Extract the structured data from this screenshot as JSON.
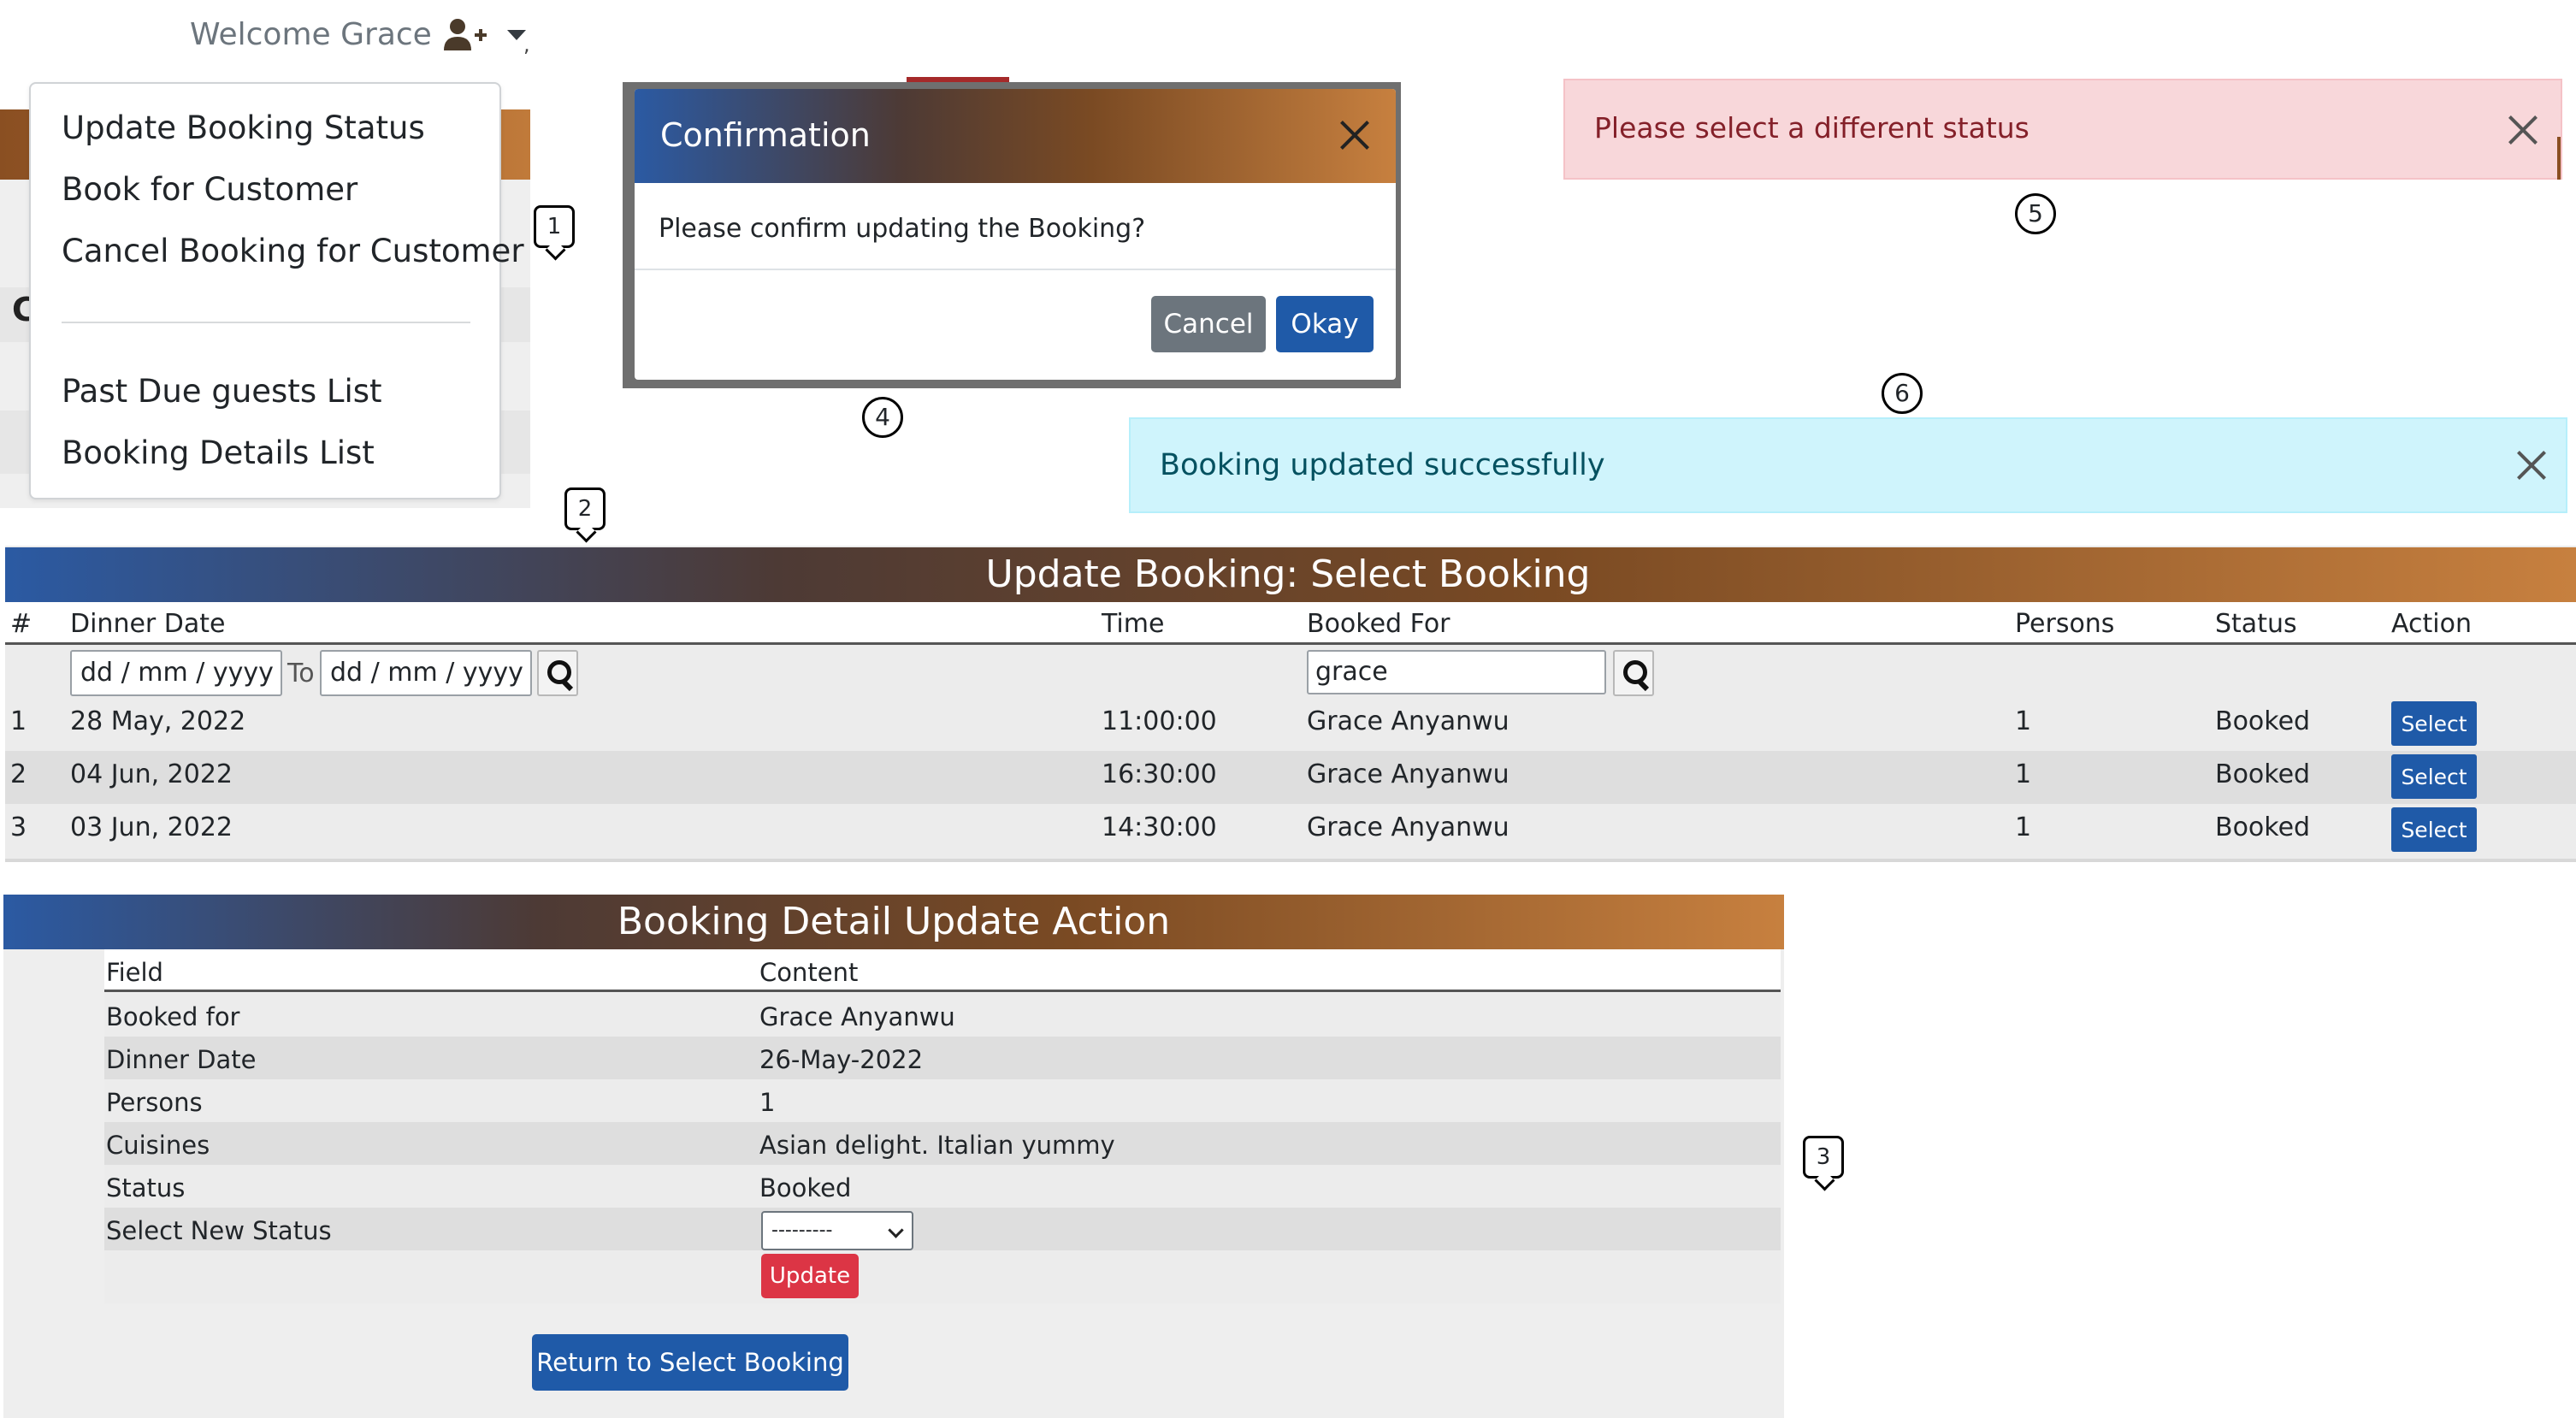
{
  "nav": {
    "welcome": "Welcome Grace",
    "menu_items": [
      "Update Booking Status",
      "Book for Customer",
      "Cancel Booking for Customer",
      "Past Due guests List",
      "Booking Details List"
    ],
    "background_letter": "C",
    "stray_mark": ","
  },
  "callouts": {
    "c1": "1",
    "c2": "2",
    "c3": "3",
    "c4": "4",
    "c5": "5",
    "c6": "6"
  },
  "modal": {
    "title": "Confirmation",
    "body": "Please confirm updating the Booking?",
    "cancel_label": "Cancel",
    "okay_label": "Okay"
  },
  "alerts": {
    "danger": "Please select a different status",
    "info": "Booking updated successfully"
  },
  "select_booking": {
    "title": "Update Booking: Select Booking",
    "columns": [
      "#",
      "Dinner Date",
      "Time",
      "Booked For",
      "Persons",
      "Status",
      "Action"
    ],
    "filters": {
      "date_from_placeholder": "dd / mm / yyyy",
      "to_label": "To",
      "date_to_placeholder": "dd / mm / yyyy",
      "search_value": "grace"
    },
    "rows": [
      {
        "n": "1",
        "date": "28 May, 2022",
        "time": "11:00:00",
        "booked_for": "Grace Anyanwu",
        "persons": "1",
        "status": "Booked",
        "action": "Select"
      },
      {
        "n": "2",
        "date": "04 Jun, 2022",
        "time": "16:30:00",
        "booked_for": "Grace Anyanwu",
        "persons": "1",
        "status": "Booked",
        "action": "Select"
      },
      {
        "n": "3",
        "date": "03 Jun, 2022",
        "time": "14:30:00",
        "booked_for": "Grace Anyanwu",
        "persons": "1",
        "status": "Booked",
        "action": "Select"
      }
    ]
  },
  "booking_detail": {
    "title": "Booking Detail Update Action",
    "col_field": "Field",
    "col_content": "Content",
    "rows": [
      {
        "field": "Booked for",
        "content": "Grace Anyanwu"
      },
      {
        "field": "Dinner Date",
        "content": "26-May-2022"
      },
      {
        "field": "Persons",
        "content": "1"
      },
      {
        "field": "Cuisines",
        "content": "Asian delight. Italian yummy"
      },
      {
        "field": "Status",
        "content": "Booked"
      }
    ],
    "new_status_label": "Select New Status",
    "new_status_value": "---------",
    "update_label": "Update",
    "return_label": "Return to Select Booking"
  },
  "colors": {
    "brand_blue": "#2b5aa3",
    "brand_brown": "#c7803f",
    "primary_button": "#1f5aa8",
    "danger_button": "#dc3545",
    "alert_danger_bg": "#f8d7da",
    "alert_info_bg": "#cff4fc"
  },
  "icons": {
    "user_add": "user-plus-icon",
    "caret": "caret-down-icon",
    "close": "close-icon",
    "search": "search-icon",
    "select_chevron": "chevron-down-icon"
  }
}
